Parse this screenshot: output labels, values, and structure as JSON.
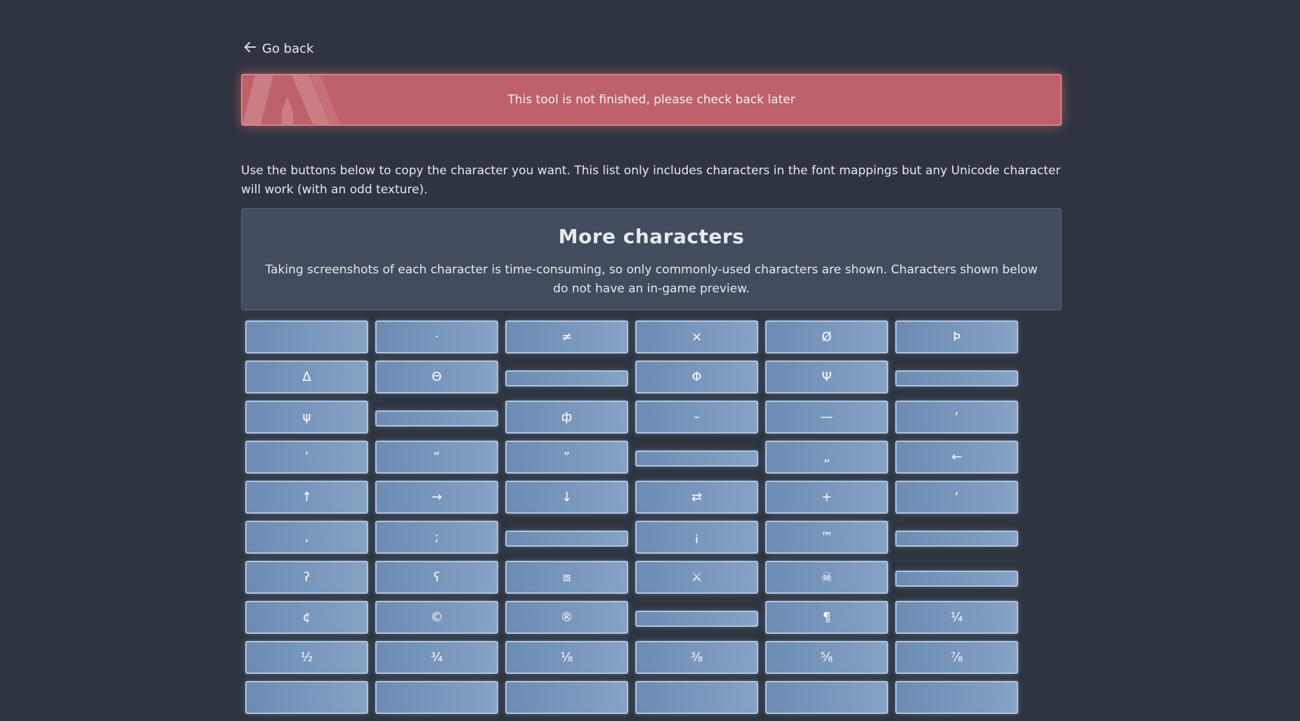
{
  "nav": {
    "back_label": "Go back"
  },
  "warning": {
    "text": "This tool is not finished, please check back later"
  },
  "intro": "Use the buttons below to copy the character you want. This list only includes characters in the font mappings but any Unicode character will work (with an odd texture).",
  "panel": {
    "title": "More characters",
    "description": "Taking screenshots of each character is time-consuming, so only commonly-used characters are shown. Characters shown below do not have an in-game preview."
  },
  "characters": [
    {
      "char": ""
    },
    {
      "char": "·"
    },
    {
      "char": "≠"
    },
    {
      "char": "×"
    },
    {
      "char": "Ø"
    },
    {
      "char": "Þ"
    },
    {
      "char": "Δ"
    },
    {
      "char": "Θ"
    },
    {
      "char": "",
      "thin": true
    },
    {
      "char": "Φ"
    },
    {
      "char": "Ψ"
    },
    {
      "char": "",
      "thin": true
    },
    {
      "char": "ψ"
    },
    {
      "char": "",
      "thin": true
    },
    {
      "char": "ф"
    },
    {
      "char": "–"
    },
    {
      "char": "—"
    },
    {
      "char": "‘"
    },
    {
      "char": "’"
    },
    {
      "char": "“"
    },
    {
      "char": "”"
    },
    {
      "char": "",
      "thin": true
    },
    {
      "char": "„"
    },
    {
      "char": "←"
    },
    {
      "char": "↑"
    },
    {
      "char": "→"
    },
    {
      "char": "↓"
    },
    {
      "char": "⇄"
    },
    {
      "char": "+"
    },
    {
      "char": "‘"
    },
    {
      "char": ","
    },
    {
      "char": ";"
    },
    {
      "char": "",
      "thin": true
    },
    {
      "char": "¡"
    },
    {
      "char": "™"
    },
    {
      "char": "",
      "thin": true
    },
    {
      "char": "ʔ"
    },
    {
      "char": "ʕ"
    },
    {
      "char": "⧈"
    },
    {
      "char": "⚔"
    },
    {
      "char": "☠"
    },
    {
      "char": "",
      "thin": true
    },
    {
      "char": "¢"
    },
    {
      "char": "©"
    },
    {
      "char": "®"
    },
    {
      "char": "",
      "thin": true
    },
    {
      "char": "¶"
    },
    {
      "char": "¼"
    },
    {
      "char": "½"
    },
    {
      "char": "¾"
    },
    {
      "char": "⅛"
    },
    {
      "char": "⅜"
    },
    {
      "char": "⅝"
    },
    {
      "char": "⅞"
    },
    {
      "char": ""
    },
    {
      "char": ""
    },
    {
      "char": ""
    },
    {
      "char": ""
    },
    {
      "char": ""
    },
    {
      "char": ""
    }
  ]
}
